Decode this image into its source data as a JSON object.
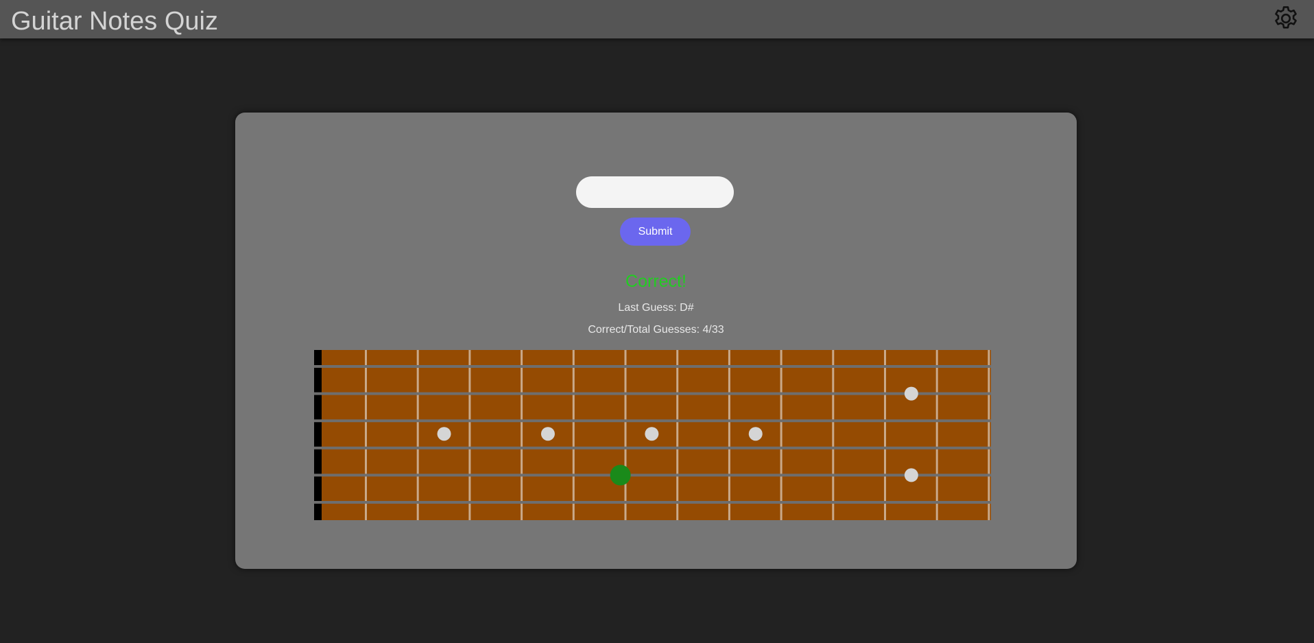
{
  "header": {
    "title": "Guitar Notes Quiz",
    "settings_icon": "gear-icon"
  },
  "quiz": {
    "input_value": "",
    "input_placeholder": "",
    "submit_label": "Submit",
    "result_text": "Correct!",
    "last_guess_label": "Last Guess: D#",
    "score_label": "Correct/Total Guesses: 4/33"
  },
  "fretboard": {
    "strings": 6,
    "frets": 13,
    "inlay_markers": [
      {
        "fret": 3,
        "string": 3
      },
      {
        "fret": 5,
        "string": 3
      },
      {
        "fret": 7,
        "string": 3
      },
      {
        "fret": 9,
        "string": 3
      },
      {
        "fret": 12,
        "string": 2
      },
      {
        "fret": 12,
        "string": 5
      }
    ],
    "active_note": {
      "fret": 6,
      "string": 5
    },
    "colors": {
      "wood": "#954b02",
      "nut": "#000000",
      "fret": "#c9a98a",
      "string": "#6e6e6e",
      "marker": "#d5d5d5",
      "active": "#1a8a1a"
    }
  },
  "colors": {
    "background": "#222222",
    "header": "#555555",
    "card": "#767676",
    "accent": "#6b67ee",
    "success": "#22cc22"
  }
}
